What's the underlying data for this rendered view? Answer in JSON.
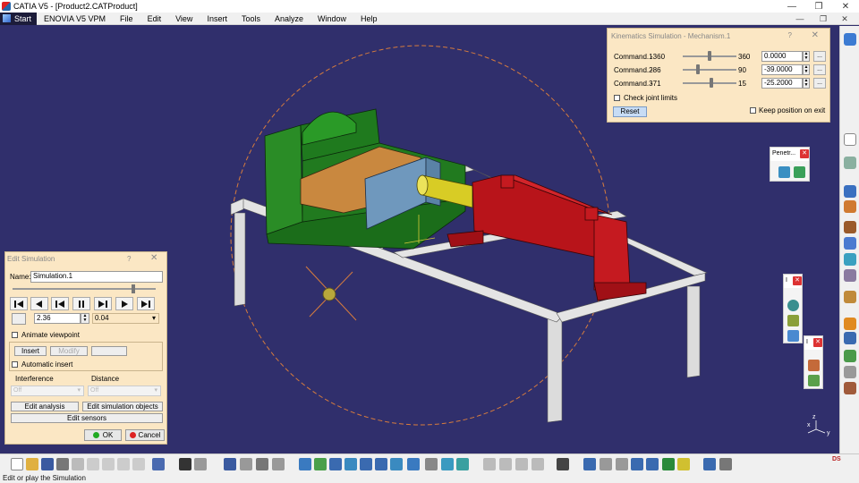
{
  "window": {
    "title": "CATIA V5 - [Product2.CATProduct]"
  },
  "menu": {
    "start": "Start",
    "items": [
      "ENOVIA V5 VPM",
      "File",
      "Edit",
      "View",
      "Insert",
      "Tools",
      "Analyze",
      "Window",
      "Help"
    ]
  },
  "kinematics": {
    "title": "Kinematics Simulation - Mechanism.1",
    "help": "?",
    "commands": [
      {
        "label": "Command.1",
        "min": "-360",
        "max": "360",
        "value": "0.0000",
        "pos": 0.5
      },
      {
        "label": "Command.2",
        "min": "-86",
        "max": "90",
        "value": "-39.0000",
        "pos": 0.27
      },
      {
        "label": "Command.3",
        "min": "-71",
        "max": "15",
        "value": "-25.2000",
        "pos": 0.53
      }
    ],
    "check_joint_limits": "Check joint limits",
    "reset": "Reset",
    "keep_position": "Keep position on exit"
  },
  "simulation": {
    "title": "Edit Simulation",
    "help": "?",
    "name_label": "Name:",
    "name_value": "Simulation.1",
    "slider_pos": 0.85,
    "step_value": "2.36",
    "step_size": "0.04",
    "animate_viewpoint": "Animate viewpoint",
    "insert": "Insert",
    "modify": "Modify",
    "automatic_insert": "Automatic insert",
    "interference_label": "Interference",
    "interference_value": "Off",
    "distance_label": "Distance",
    "distance_value": "Off",
    "edit_analysis": "Edit analysis",
    "edit_sim_objects": "Edit simulation objects",
    "edit_sensors": "Edit sensors",
    "ok": "OK",
    "cancel": "Cancel"
  },
  "floating": {
    "penetration_title": "Penetr...",
    "t2_title": "I",
    "t3_title": "I"
  },
  "status": {
    "text": "Edit or play the Simulation"
  },
  "colors": {
    "viewport_bg": "#302f6c",
    "dialog_bg": "#fbe7c4",
    "vise_green": "#1f7a1e",
    "cylinder_red": "#b8141a",
    "jaw_blue": "#6f98bd",
    "rod_yellow": "#d8cc25",
    "frame_gray": "#e2e2e2"
  }
}
